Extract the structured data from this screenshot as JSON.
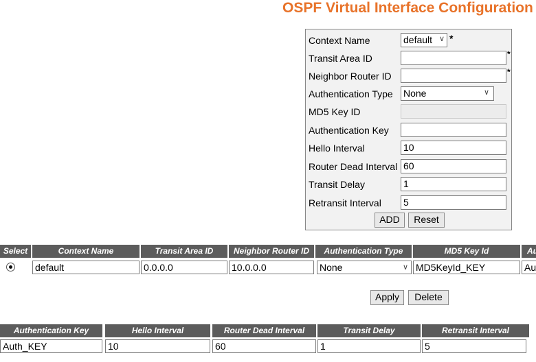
{
  "page_title": "OSPF Virtual Interface Configuration",
  "form": {
    "context_name": {
      "label": "Context Name",
      "value": "default"
    },
    "transit_area_id": {
      "label": "Transit Area ID",
      "value": ""
    },
    "neighbor_router_id": {
      "label": "Neighbor Router ID",
      "value": ""
    },
    "authentication_type": {
      "label": "Authentication Type",
      "value": "None"
    },
    "md5_key_id": {
      "label": "MD5 Key ID",
      "value": ""
    },
    "authentication_key": {
      "label": "Authentication Key",
      "value": ""
    },
    "hello_interval": {
      "label": "Hello Interval",
      "value": "10"
    },
    "router_dead_interval": {
      "label": "Router Dead Interval",
      "value": "60"
    },
    "transit_delay": {
      "label": "Transit Delay",
      "value": "1"
    },
    "retransit_interval": {
      "label": "Retransit Interval",
      "value": "5"
    },
    "required_marker": "*",
    "add_label": "ADD",
    "reset_label": "Reset"
  },
  "table1": {
    "headers": [
      "Select",
      "Context Name",
      "Transit Area ID",
      "Neighbor Router ID",
      "Authentication Type",
      "MD5 Key Id",
      "Authentication Key"
    ],
    "row": {
      "selected": true,
      "context_name": "default",
      "transit_area_id": "0.0.0.0",
      "neighbor_router_id": "10.0.0.0",
      "authentication_type": "None",
      "md5_key_id": "MD5KeyId_KEY",
      "authentication_key": "Au"
    }
  },
  "apply_label": "Apply",
  "delete_label": "Delete",
  "table2": {
    "headers": [
      "Authentication Key",
      "Hello Interval",
      "Router Dead Interval",
      "Transit Delay",
      "Retransit Interval"
    ],
    "row": {
      "authentication_key": "Auth_KEY",
      "hello_interval": "10",
      "router_dead_interval": "60",
      "transit_delay": "1",
      "retransit_interval": "5"
    }
  }
}
